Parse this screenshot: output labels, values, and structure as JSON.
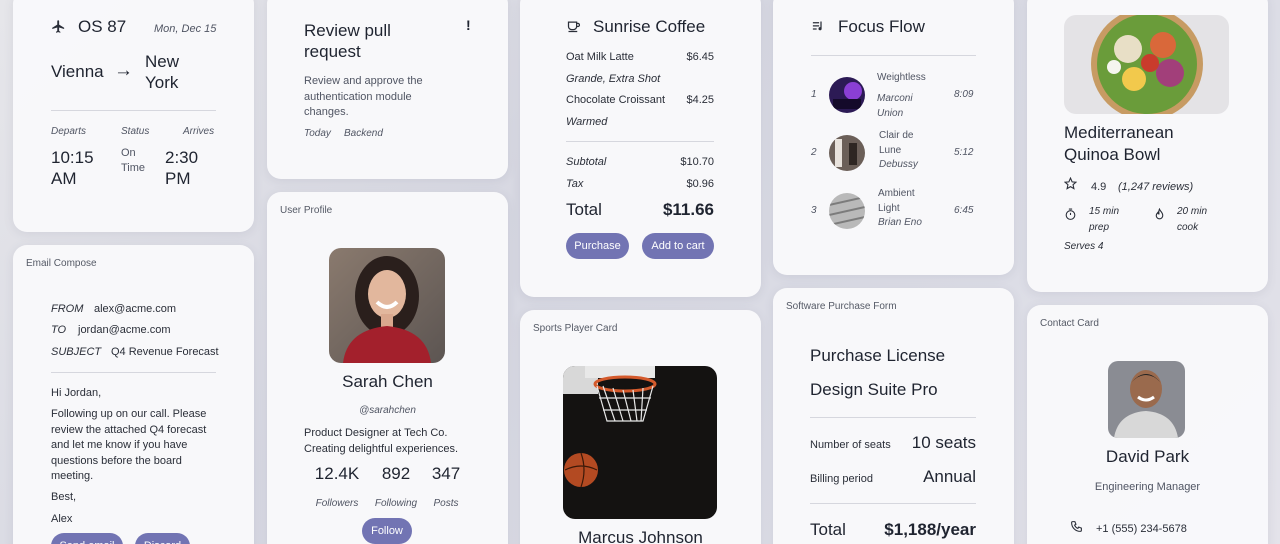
{
  "flight": {
    "code": "OS 87",
    "date": "Mon, Dec 15",
    "origin": "Vienna",
    "arrow": "→",
    "destination": "New York",
    "departs_label": "Departs",
    "status_label": "Status",
    "arrives_label": "Arrives",
    "departs_time": "10:15 AM",
    "status_value": "On Time",
    "arrives_time": "2:30 PM"
  },
  "email": {
    "tag": "Email Compose",
    "from_label": "FROM",
    "from_value": "alex@acme.com",
    "to_label": "TO",
    "to_value": "jordan@acme.com",
    "subject_label": "SUBJECT",
    "subject_value": "Q4 Revenue Forecast",
    "greeting": "Hi Jordan,",
    "body": "Following up on our call. Please review the attached Q4 forecast and let me know if you have questions before the board meeting.",
    "signoff": "Best,",
    "signature": "Alex",
    "send_label": "Send email",
    "discard_label": "Discard"
  },
  "task": {
    "title": "Review pull request",
    "priority": "!",
    "description": "Review and approve the authentication module changes.",
    "due": "Today",
    "category": "Backend"
  },
  "profile": {
    "tag": "User Profile",
    "name": "Sarah Chen",
    "handle": "@sarahchen",
    "bio": "Product Designer at Tech Co. Creating delightful experiences.",
    "followers": "12.4K",
    "following": "892",
    "posts": "347",
    "followers_label": "Followers",
    "following_label": "Following",
    "posts_label": "Posts",
    "follow_label": "Follow"
  },
  "coffee": {
    "title": "Sunrise Coffee",
    "items": [
      {
        "name": "Oat Milk Latte",
        "price": "$6.45",
        "note": "Grande, Extra Shot"
      },
      {
        "name": "Chocolate Croissant",
        "price": "$4.25",
        "note": "Warmed"
      }
    ],
    "subtotal_label": "Subtotal",
    "subtotal": "$10.70",
    "tax_label": "Tax",
    "tax": "$0.96",
    "total_label": "Total",
    "total": "$11.66",
    "purchase_label": "Purchase",
    "cart_label": "Add to cart"
  },
  "player": {
    "tag": "Sports Player Card",
    "name": "Marcus Johnson"
  },
  "music": {
    "title": "Focus Flow",
    "tracks": [
      {
        "num": "1",
        "title": "Weightless",
        "artist": "Marconi Union",
        "duration": "8:09"
      },
      {
        "num": "2",
        "title": "Clair de Lune",
        "artist": "Debussy",
        "duration": "5:12"
      },
      {
        "num": "3",
        "title": "Ambient Light",
        "artist": "Brian Eno",
        "duration": "6:45"
      }
    ]
  },
  "license": {
    "tag": "Software Purchase Form",
    "heading": "Purchase License",
    "product": "Design Suite Pro",
    "seats_label": "Number of seats",
    "seats_value": "10 seats",
    "billing_label": "Billing period",
    "billing_value": "Annual",
    "total_label": "Total",
    "total_value": "$1,188/year"
  },
  "recipe": {
    "title": "Mediterranean Quinoa Bowl",
    "rating": "4.9",
    "reviews": "(1,247 reviews)",
    "prep": "15 min prep",
    "cook": "20 min cook",
    "serves": "Serves 4"
  },
  "contact": {
    "tag": "Contact Card",
    "name": "David Park",
    "role": "Engineering Manager",
    "phone": "+1 (555) 234-5678"
  }
}
